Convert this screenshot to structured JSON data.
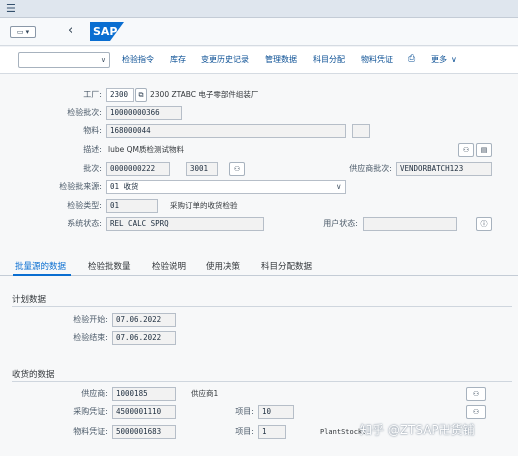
{
  "app": {
    "logo_text": "SAP"
  },
  "window_icon": {
    "label": "▭ ▾"
  },
  "toolbar": {
    "buttons": [
      "检验指令",
      "库存",
      "变更历史记录",
      "管理数据",
      "科目分配",
      "物料凭证",
      "更多"
    ]
  },
  "header": {
    "plant_label": "工厂:",
    "plant_value": "2300",
    "plant_desc": "2300 ZTABC 电子零部件组装厂",
    "lot_label": "检验批次:",
    "lot_value": "10000000366",
    "material_label": "物料:",
    "material_value": "168000044",
    "desc_label": "描述:",
    "desc_value": "lube QM质检测试物料",
    "batch_label": "批次:",
    "batch_value": "0000000222",
    "batch_extra": "3001",
    "vendor_batch_label": "供应商批次:",
    "vendor_batch_value": "VENDORBATCH123",
    "origin_label": "检验批来源:",
    "origin_value": "01 收货",
    "type_label": "检验类型:",
    "type_value": "01",
    "type_desc": "采购订单的收货检验",
    "status_label": "系统状态:",
    "status_value": "REL  CALC SPRQ",
    "user_status_label": "用户状态:",
    "user_status_value": ""
  },
  "tabs": [
    "批量源的数据",
    "检验批数量",
    "检验说明",
    "使用决策",
    "科目分配数据"
  ],
  "plan": {
    "title": "计划数据",
    "start_label": "检验开始:",
    "start_value": "07.06.2022",
    "end_label": "检验结束:",
    "end_value": "07.06.2022"
  },
  "receipt": {
    "title": "收货的数据",
    "vendor_label": "供应商:",
    "vendor_value": "1000185",
    "vendor_name": "供应商1",
    "po_label": "采购凭证:",
    "po_value": "4500001110",
    "po_item_label": "项目:",
    "po_item_value": "10",
    "matdoc_label": "物料凭证:",
    "matdoc_value": "5000001683",
    "matdoc_item_label": "项目:",
    "matdoc_item_value": "1",
    "plant_stock_label": "PlantStock:"
  },
  "watermark": "知乎 @ZTSAP卍货铺"
}
